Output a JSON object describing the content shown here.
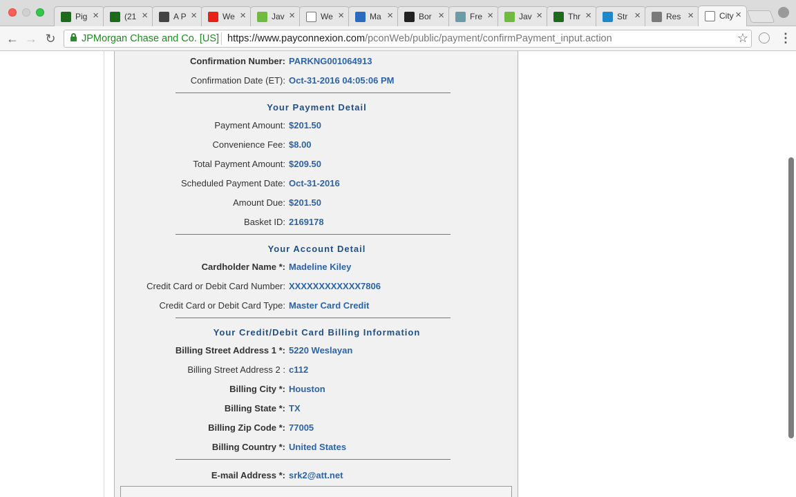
{
  "browser": {
    "tabs": [
      {
        "title": "Pig",
        "icon": "upwork-icon",
        "fav_color": "#1c6b1c"
      },
      {
        "title": "(21",
        "icon": "upwork-icon",
        "fav_color": "#1c6b1c"
      },
      {
        "title": "A P",
        "icon": "codepen-icon",
        "fav_color": "#444444"
      },
      {
        "title": "We",
        "icon": "youtube-icon",
        "fav_color": "#e62117"
      },
      {
        "title": "Jav",
        "icon": "w3-icon",
        "fav_color": "#6fba3f"
      },
      {
        "title": "We",
        "icon": "document-icon",
        "fav_color": "#ffffff"
      },
      {
        "title": "Ma",
        "icon": "mail-icon",
        "fav_color": "#2a6bbf"
      },
      {
        "title": "Bor",
        "icon": "github-icon",
        "fav_color": "#222222"
      },
      {
        "title": "Fre",
        "icon": "freecodecamp-icon",
        "fav_color": "#6a9ca8"
      },
      {
        "title": "Jav",
        "icon": "w3-icon",
        "fav_color": "#6fba3f"
      },
      {
        "title": "Thr",
        "icon": "upwork-icon",
        "fav_color": "#1c6b1c"
      },
      {
        "title": "Str",
        "icon": "stack-icon",
        "fav_color": "#1e88c9"
      },
      {
        "title": "Res",
        "icon": "avatar-icon",
        "fav_color": "#7a7a7a"
      },
      {
        "title": "City",
        "icon": "document-icon",
        "fav_color": "#ffffff",
        "active": true
      }
    ],
    "close_glyph": "×",
    "cert_name": "JPMorgan Chase and Co. [US]",
    "url_scheme_host": "https://www.payconnexion.com",
    "url_path": "/pconWeb/public/payment/confirmPayment_input.action"
  },
  "confirmation": {
    "number_label": "Confirmation Number:",
    "number_value": "PARKNG001064913",
    "date_label": "Confirmation Date (ET):",
    "date_value": "Oct-31-2016 04:05:06 PM"
  },
  "payment": {
    "heading": "Your Payment Detail",
    "rows": [
      {
        "label": "Payment Amount:",
        "value": "$201.50"
      },
      {
        "label": "Convenience Fee:",
        "value": "$8.00"
      },
      {
        "label": "Total Payment Amount:",
        "value": "$209.50"
      },
      {
        "label": "Scheduled Payment Date:",
        "value": "Oct-31-2016"
      },
      {
        "label": "Amount Due:",
        "value": "$201.50"
      },
      {
        "label": "Basket ID:",
        "value": "2169178"
      }
    ]
  },
  "account": {
    "heading": "Your Account Detail",
    "rows": [
      {
        "label": "Cardholder Name *:",
        "value": "Madeline Kiley",
        "required": true
      },
      {
        "label": "Credit Card or Debit Card Number:",
        "value": "XXXXXXXXXXXX7806",
        "required": false
      },
      {
        "label": "Credit Card or Debit Card Type:",
        "value": "Master Card Credit",
        "required": false
      }
    ]
  },
  "billing": {
    "heading": "Your Credit/Debit Card Billing Information",
    "rows": [
      {
        "label": "Billing Street Address 1 *:",
        "value": "5220 Weslayan",
        "required": true
      },
      {
        "label": "Billing Street Address 2 :",
        "value": "c112",
        "required": false
      },
      {
        "label": "Billing City *:",
        "value": "Houston",
        "required": true
      },
      {
        "label": "Billing State *:",
        "value": "TX",
        "required": true
      },
      {
        "label": "Billing Zip Code *:",
        "value": "77005",
        "required": true
      },
      {
        "label": "Billing Country *:",
        "value": "United States",
        "required": true
      }
    ]
  },
  "email": {
    "label": "E-mail Address *:",
    "value": "srk2@att.net"
  }
}
